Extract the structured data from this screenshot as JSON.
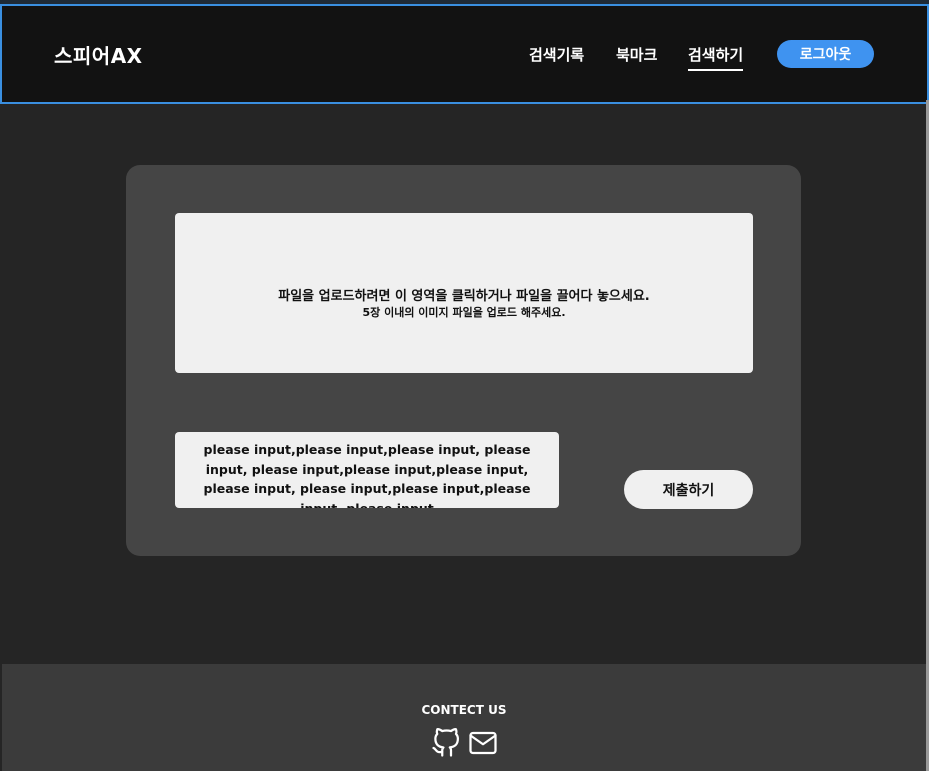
{
  "header": {
    "logo": "스피어AX",
    "nav": [
      "검색기록",
      "북마크",
      "검색하기"
    ],
    "active_nav": "검색하기",
    "logout_label": "로그아웃",
    "accent_color": "#3f93f0"
  },
  "upload": {
    "dropzone_main": "파일을 업로드하려면 이 영역을 클릭하거나 파일을 끌어다 놓으세요.",
    "dropzone_sub": "5장 이내의 이미지 파일을 업로드 해주세요.",
    "text_value": "please input,please input,please input, please input, please input,please input,please input, please input, please input,please input,please input, please input",
    "submit_label": "제출하기"
  },
  "footer": {
    "title": "CONTECT US",
    "icons": [
      "github-icon",
      "mail-icon"
    ]
  }
}
